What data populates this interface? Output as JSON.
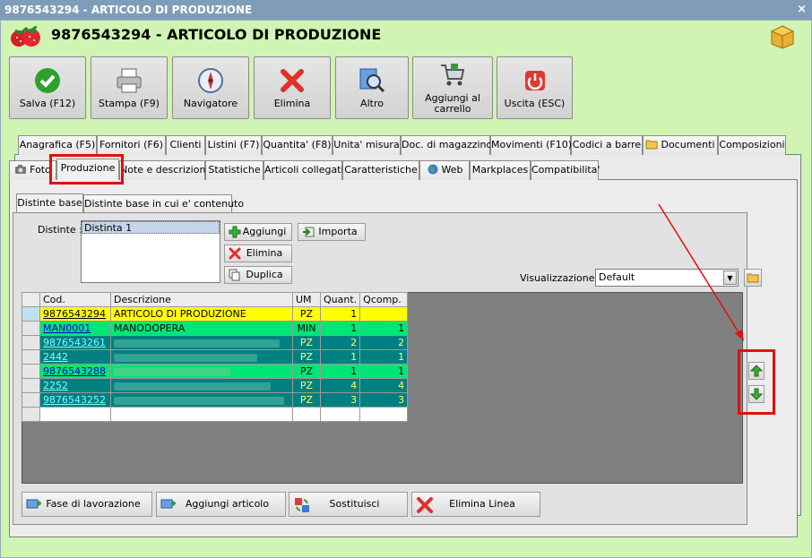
{
  "window": {
    "title": "9876543294 - ARTICOLO DI PRODUZIONE",
    "close": "×"
  },
  "header": {
    "title": "9876543294 - ARTICOLO DI PRODUZIONE"
  },
  "toolbar": [
    {
      "label": "Salva (F12)",
      "icon": "check-icon"
    },
    {
      "label": "Stampa (F9)",
      "icon": "printer-icon"
    },
    {
      "label": "Navigatore",
      "icon": "compass-icon"
    },
    {
      "label": "Elimina",
      "icon": "delete-icon"
    },
    {
      "label": "Altro",
      "icon": "magnifier-icon"
    },
    {
      "label": "Aggiungi al carrello",
      "icon": "cart-icon"
    },
    {
      "label": "Uscita (ESC)",
      "icon": "power-icon"
    }
  ],
  "tabs_row1": [
    "Anagrafica (F5)",
    "Fornitori (F6)",
    "Clienti",
    "Listini (F7)",
    "Quantita' (F8)",
    "Unita' misura",
    "Doc. di magazzino",
    "Movimenti (F10)",
    "Codici a barre",
    "Documenti",
    "Composizioni"
  ],
  "tabs_row2": [
    "Foto",
    "Produzione",
    "Note e descrizioni",
    "Statistiche",
    "Articoli collegati",
    "Caratteristiche",
    "Web",
    "Markplaces",
    "Compatibilita'"
  ],
  "subtabs": [
    "Distinte base",
    "Distinte base in cui e' contenuto"
  ],
  "distinte": {
    "label": "Distinte :",
    "items": [
      "Distinta 1"
    ],
    "buttons": [
      "Aggiungi",
      "Elimina",
      "Duplica"
    ],
    "import_label": "Importa"
  },
  "visualizzazione": {
    "label": "Visualizzazione :",
    "value": "Default"
  },
  "grid": {
    "columns": [
      "Cod.",
      "Descrizione",
      "UM",
      "Quant.",
      "Qcomp."
    ],
    "rows": [
      {
        "cod": "9876543294",
        "desc": "ARTICOLO DI PRODUZIONE",
        "um": "PZ",
        "quant": "1",
        "qcomp": "",
        "style": "yellow"
      },
      {
        "cod": "MAN0001",
        "desc": "MANODOPERA",
        "um": "MIN",
        "quant": "1",
        "qcomp": "1",
        "style": "green"
      },
      {
        "cod": "9876543261",
        "desc": "",
        "um": "PZ",
        "quant": "2",
        "qcomp": "2",
        "style": "teal"
      },
      {
        "cod": "2442",
        "desc": "",
        "um": "PZ",
        "quant": "1",
        "qcomp": "1",
        "style": "teal"
      },
      {
        "cod": "9876543288",
        "desc": "",
        "um": "PZ",
        "quant": "1",
        "qcomp": "1",
        "style": "green"
      },
      {
        "cod": "2252",
        "desc": "",
        "um": "PZ",
        "quant": "4",
        "qcomp": "4",
        "style": "teal"
      },
      {
        "cod": "9876543252",
        "desc": "",
        "um": "PZ",
        "quant": "3",
        "qcomp": "3",
        "style": "teal"
      }
    ]
  },
  "bottom_buttons": [
    "Fase di lavorazione",
    "Aggiungi articolo",
    "Sostituisci",
    "Elimina Linea"
  ],
  "colors": {
    "yellow_row": "#ffff00",
    "green_row": "#00e676",
    "teal_row": "#008080",
    "teal_text": "#ffff66",
    "annotation": "#e01010"
  }
}
